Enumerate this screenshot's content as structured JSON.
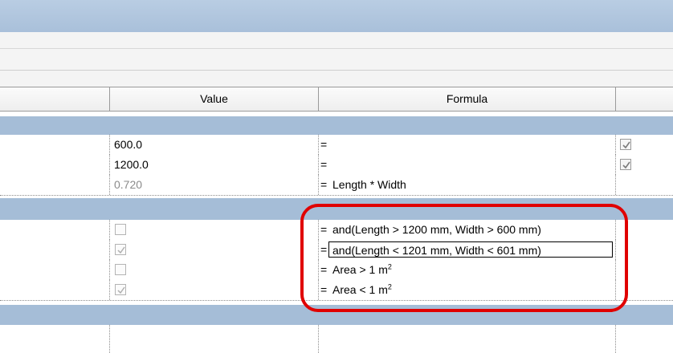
{
  "columns": {
    "value": "Value",
    "formula": "Formula"
  },
  "rows": [
    {
      "value": "600.0",
      "eq": "=",
      "formula": "",
      "check": "checked"
    },
    {
      "value": "1200.0",
      "eq": "=",
      "formula": "",
      "check": "checked"
    },
    {
      "value": "0.720",
      "eq": "=",
      "formula": "Length * Width"
    },
    {
      "value": "",
      "eq": "=",
      "formula": "and(Length > 1200 mm, Width > 600 mm)",
      "value_check": "unchecked"
    },
    {
      "value": "",
      "eq": "=",
      "formula": "and(Length < 1201 mm, Width < 601 mm)",
      "value_check": "checked"
    },
    {
      "value": "",
      "eq": "=",
      "formula": "Area > 1 m",
      "unit_sup": "2",
      "value_check": "unchecked"
    },
    {
      "value": "",
      "eq": "=",
      "formula": "Area < 1 m",
      "unit_sup": "2",
      "value_check": "checked"
    }
  ],
  "colors": {
    "title_bar": "#b4c8df",
    "group_band": "#a5bdd7",
    "highlight": "#e00000"
  },
  "icons": {
    "check": "checkmark-icon"
  }
}
